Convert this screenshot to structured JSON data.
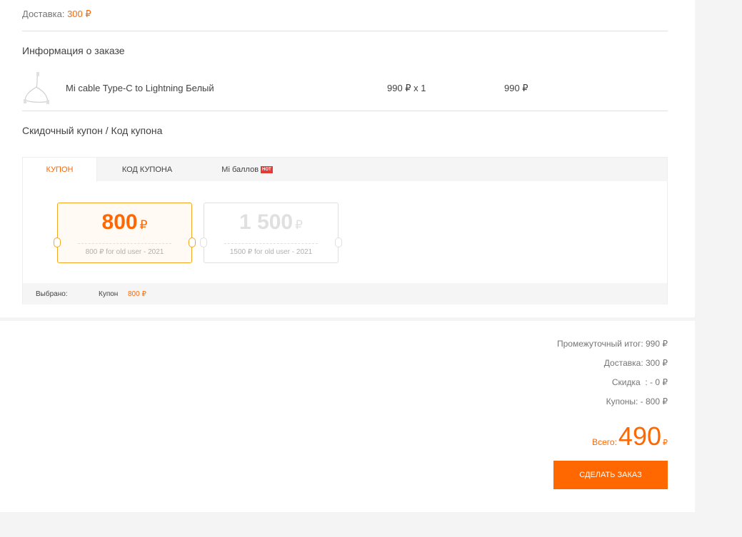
{
  "delivery": {
    "label": "Доставка:",
    "value": "300 ₽"
  },
  "order_info": {
    "title": "Информация о заказе"
  },
  "product": {
    "name": "Mi cable Type-C to Lightning Белый",
    "price_qty": "990 ₽ x 1",
    "total": "990 ₽"
  },
  "coupon_section": {
    "title": "Скидочный купон / Код купона"
  },
  "tabs": [
    {
      "label": "КУПОН"
    },
    {
      "label": "КОД КУПОНА"
    },
    {
      "label": "Mi баллов",
      "badge": "HOT"
    }
  ],
  "coupons": [
    {
      "amount": "800",
      "currency": "₽",
      "desc": "800 ₽ for old user - 2021",
      "selected": true
    },
    {
      "amount": "1 500",
      "currency": "₽",
      "desc": "1500 ₽ for old user - 2021",
      "selected": false
    }
  ],
  "selected_bar": {
    "label": "Выбрано:",
    "kind": "Купон",
    "amount": "800 ₽"
  },
  "summary": {
    "subtotal": "Промежуточный итог: 990 ₽",
    "delivery": "Доставка: 300 ₽",
    "discount": "Скидка  : - 0 ₽",
    "coupons": "Купоны: - 800 ₽"
  },
  "total": {
    "label": "Всего:",
    "value": "490",
    "currency": "₽"
  },
  "order_button": {
    "label": "СДЕЛАТЬ ЗАКАЗ"
  },
  "colors": {
    "accent": "#ff6700",
    "ticket_border": "#f5a623"
  }
}
